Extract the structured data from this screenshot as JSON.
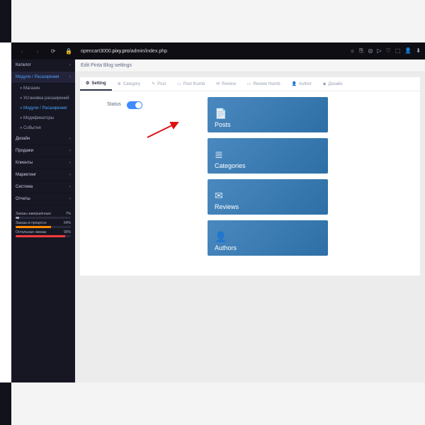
{
  "browser": {
    "url_prefix": "opencart3000.",
    "url_host": "pixy.pro",
    "url_path": "/admin/index.php"
  },
  "sidebar": {
    "items": [
      {
        "label": "Каталог",
        "type": "grp"
      },
      {
        "label": "Модули / Расширения",
        "type": "grp",
        "active": true
      },
      {
        "label": "Магазин",
        "type": "sub"
      },
      {
        "label": "Установка расширений",
        "type": "sub"
      },
      {
        "label": "Модули / Расширения",
        "type": "sub",
        "hl": true
      },
      {
        "label": "Модификаторы",
        "type": "sub"
      },
      {
        "label": "События",
        "type": "sub"
      },
      {
        "label": "Дизайн",
        "type": "grp"
      },
      {
        "label": "Продажи",
        "type": "grp"
      },
      {
        "label": "Клиенты",
        "type": "grp"
      },
      {
        "label": "Маркетинг",
        "type": "grp"
      },
      {
        "label": "Система",
        "type": "grp"
      },
      {
        "label": "Отчеты",
        "type": "grp"
      }
    ],
    "stats": [
      {
        "label": "Заказы завершённые",
        "value": "7%"
      },
      {
        "label": "Заказы в процессе",
        "value": "64%"
      },
      {
        "label": "Остальные заказы",
        "value": "90%"
      }
    ]
  },
  "page": {
    "breadcrumb": "Edit Pinta Blog settings",
    "tabs": [
      {
        "icon": "⚙",
        "label": "Setting",
        "active": true
      },
      {
        "icon": "≣",
        "label": "Category"
      },
      {
        "icon": "✎",
        "label": "Post"
      },
      {
        "icon": "▭",
        "label": "Post thumb"
      },
      {
        "icon": "✉",
        "label": "Review"
      },
      {
        "icon": "▭",
        "label": "Review thumb"
      },
      {
        "icon": "👤",
        "label": "Author"
      },
      {
        "icon": "◆",
        "label": "Дизайн"
      }
    ],
    "status_label": "Status",
    "cards": [
      {
        "icon": "📄",
        "label": "Posts"
      },
      {
        "icon": "≣",
        "label": "Categories"
      },
      {
        "icon": "✉",
        "label": "Reviews"
      },
      {
        "icon": "👤",
        "label": "Authors"
      }
    ]
  }
}
